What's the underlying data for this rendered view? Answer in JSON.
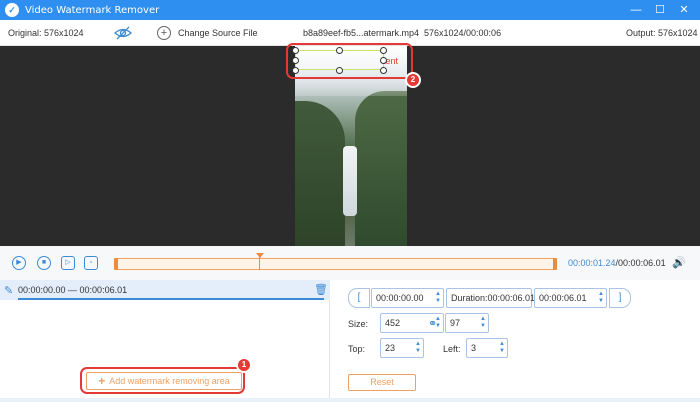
{
  "window": {
    "title": "Video Watermark Remover",
    "minimize_icon": "—",
    "maximize_icon": "☐",
    "close_icon": "✕"
  },
  "infobar": {
    "original": "Original: 576x1024",
    "change_source": "Change Source File",
    "filename": "b8a89eef-fb5...atermark.mp4",
    "res_duration": "576x1024/00:00:06",
    "output": "Output: 576x1024"
  },
  "preview": {
    "watermark_text": "tent"
  },
  "callouts": {
    "badge1": "1",
    "badge2": "2"
  },
  "controls": {
    "play_icon": "▶",
    "stop_icon": "■",
    "next_frame_icon": "▷",
    "clip_icon": "▫",
    "current_time": "00:00:01.24",
    "total_time": "/00:00:06.01",
    "volume_icon": "🔊"
  },
  "segment": {
    "range": "00:00:00.00 — 00:00:06.01",
    "brush_icon": "✎",
    "trash_icon": "🗑"
  },
  "add_area": {
    "icon": "+",
    "label": "Add watermark removing area"
  },
  "settings": {
    "start_bracket": "[",
    "end_bracket": "]",
    "start_time": "00:00:00.00",
    "duration": "Duration:00:00:06.01",
    "end_time": "00:00:06.01",
    "size_label": "Size:",
    "width": "452",
    "height": "97",
    "link_icon": "⚭",
    "top_label": "Top:",
    "top": "23",
    "left_label": "Left:",
    "left": "3",
    "spin_up": "▲",
    "spin_down": "▼",
    "reset_label": "Reset"
  }
}
